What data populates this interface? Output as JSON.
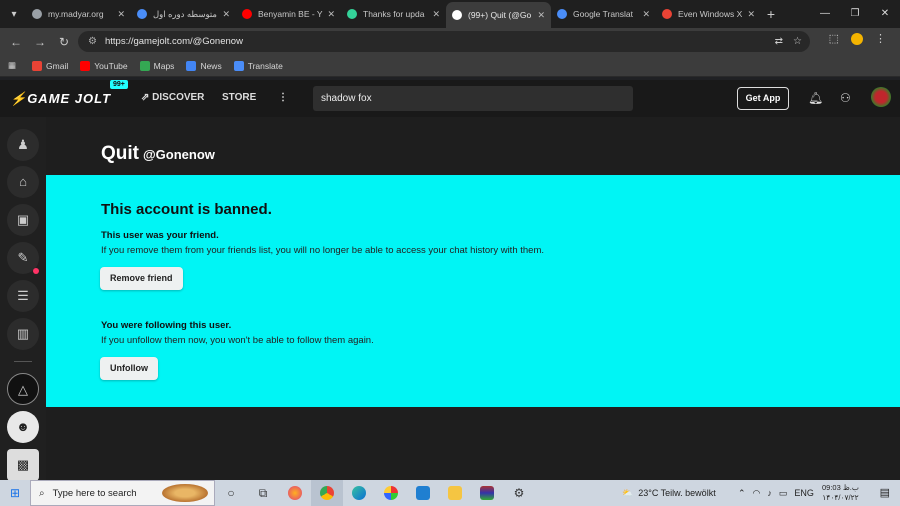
{
  "browser": {
    "tabs": [
      {
        "title": "my.madyar.org",
        "color": "#9aa0a6"
      },
      {
        "title": "متوسطه دوره اول",
        "color": "#4a8df8"
      },
      {
        "title": "Benyamin BE - Y",
        "color": "#ff0000"
      },
      {
        "title": "Thanks for upda",
        "color": "#34d399"
      },
      {
        "title": "(99+) Quit (@Go",
        "color": "#ffffff"
      },
      {
        "title": "Google Translat",
        "color": "#4a8df8"
      },
      {
        "title": "Even Windows X",
        "color": "#ea4335"
      }
    ],
    "active_tab": 4,
    "url": "https://gamejolt.com/@Gonenow",
    "bookmarks": [
      {
        "label": "Gmail",
        "color": "#ea4335"
      },
      {
        "label": "YouTube",
        "color": "#ff0000"
      },
      {
        "label": "Maps",
        "color": "#34a853"
      },
      {
        "label": "News",
        "color": "#4285f4"
      },
      {
        "label": "Translate",
        "color": "#4a8df8"
      }
    ]
  },
  "gamejolt": {
    "logo": "GAME JOLT",
    "notif_badge": "99+",
    "nav_discover": "DISCOVER",
    "nav_store": "STORE",
    "search_value": "shadow fox",
    "get_app": "Get App"
  },
  "profile": {
    "name": "Quit",
    "username": "@Gonenow"
  },
  "banned": {
    "heading": "This account is banned.",
    "friend_title": "This user was your friend.",
    "friend_text": "If you remove them from your friends list, you will no longer be able to access your chat history with them.",
    "remove_friend": "Remove friend",
    "follow_title": "You were following this user.",
    "follow_text": "If you unfollow them now, you won't be able to follow them again.",
    "unfollow": "Unfollow",
    "accent_color": "#00f5f5"
  },
  "taskbar": {
    "search_placeholder": "Type here to search",
    "weather": "23°C  Teilw. bewölkt",
    "lang": "ENG",
    "time": "09:03 ب.ظ",
    "date": "۱۴۰۴/۰۷/۲۲"
  }
}
